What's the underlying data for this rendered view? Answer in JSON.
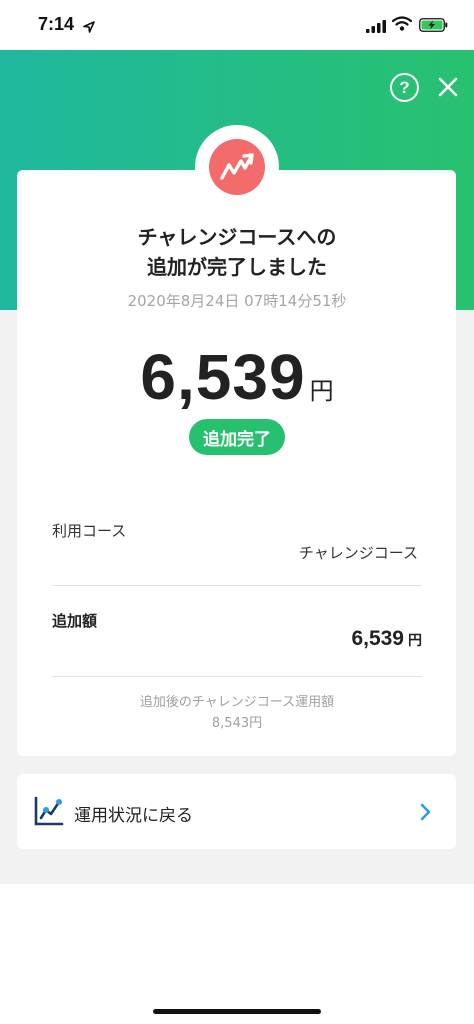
{
  "status_bar": {
    "time": "7:14"
  },
  "header": {
    "help_label": "?"
  },
  "card": {
    "title_line1": "チャレンジコースへの",
    "title_line2": "追加が完了しました",
    "datetime": "2020年8月24日 07時14分51秒",
    "amount": "6,539",
    "amount_unit": "円",
    "status_label": "追加完了",
    "course_label": "利用コース",
    "course_value": "チャレンジコース",
    "added_label": "追加額",
    "added_value": "6,539",
    "added_unit": "円",
    "note_label": "追加後のチャレンジコース運用額",
    "note_value": "8,543円"
  },
  "link": {
    "label": "運用状況に戻る"
  },
  "colors": {
    "brand_green": "#27c06f",
    "gradient_start": "#1fb89f",
    "badge_red": "#f36b6b",
    "chevron_blue": "#2a9ee0"
  }
}
